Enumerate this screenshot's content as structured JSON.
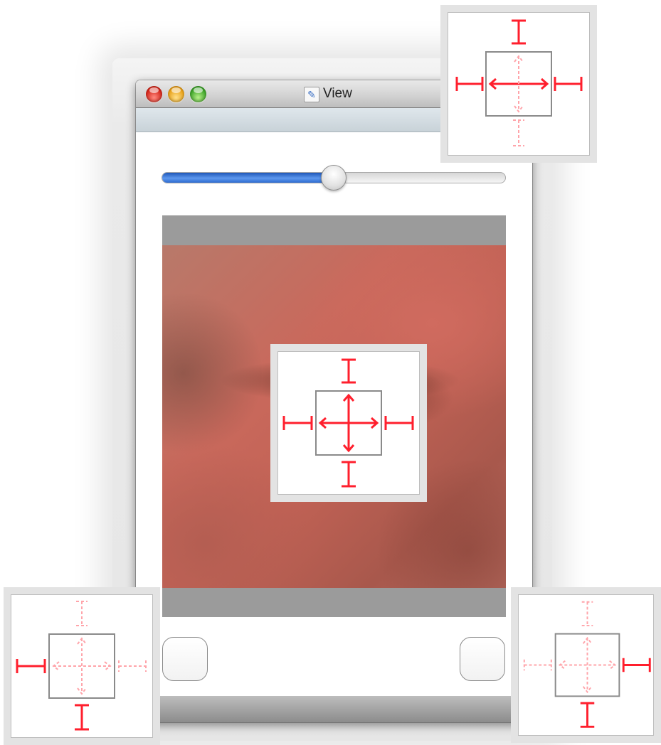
{
  "window": {
    "title": "View",
    "title_icon": "interface-builder-document-icon",
    "buttons": [
      "close-button",
      "minimize-button",
      "zoom-button"
    ]
  },
  "slider": {
    "value": 0.5
  },
  "image_view": {
    "content": "close-up-eye-photo"
  },
  "buttons": {
    "left": "rounded-button",
    "right": "rounded-button"
  },
  "autosizing_panels": [
    {
      "name": "top-right",
      "top": "fixed",
      "bottom": "flexible",
      "left": "fixed",
      "right": "fixed",
      "width": "flexible",
      "height": "flexible",
      "height_active": false
    },
    {
      "name": "center",
      "top": "fixed",
      "bottom": "fixed",
      "left": "fixed",
      "right": "fixed",
      "width": "flexible",
      "height": "flexible"
    },
    {
      "name": "bottom-left",
      "top": "flexible",
      "bottom": "fixed",
      "left": "fixed",
      "right": "flexible",
      "width": "flexible",
      "height": "flexible"
    },
    {
      "name": "bottom-right",
      "top": "flexible",
      "bottom": "fixed",
      "left": "flexible",
      "right": "fixed",
      "width": "flexible",
      "height": "flexible"
    }
  ],
  "colors": {
    "strut_active": "#ff1f2d",
    "strut_inactive": "#ffa4aa",
    "slider_fill": "#3a78dc",
    "image_well": "#9b9b9b"
  }
}
